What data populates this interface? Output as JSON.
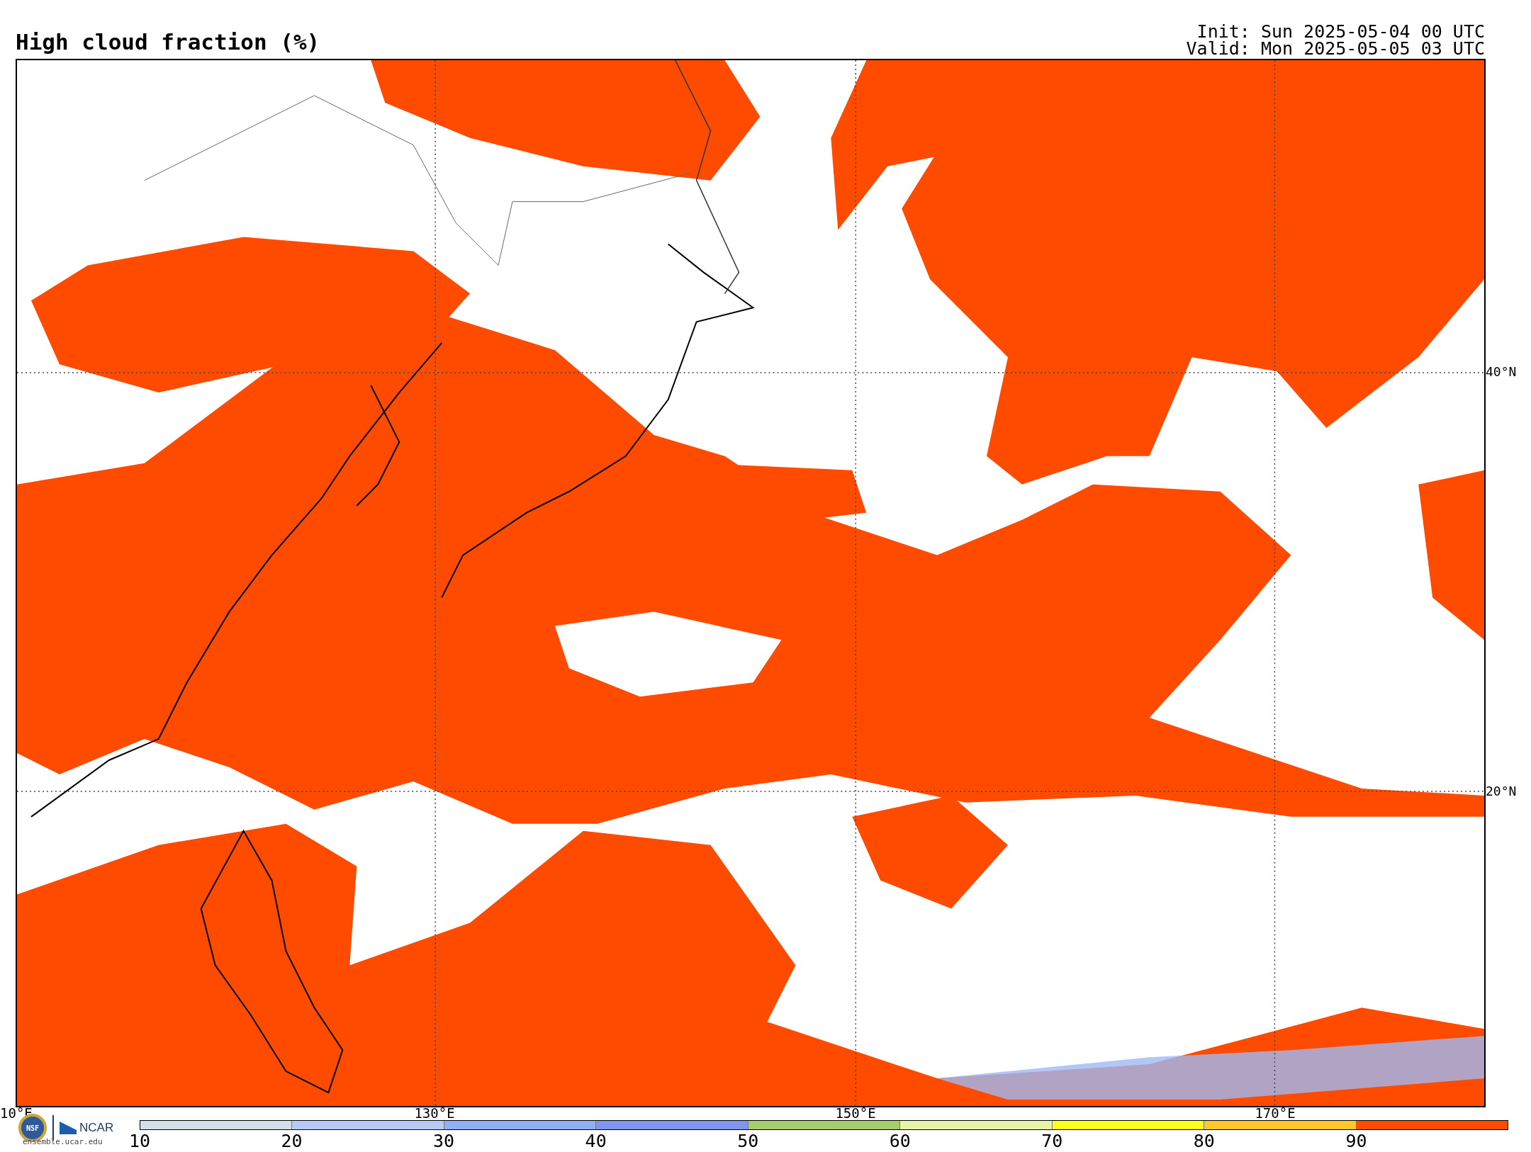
{
  "title": "High cloud fraction (%)",
  "init": "Init: Sun 2025-05-04 00 UTC",
  "valid": "Valid: Mon 2025-05-05 03 UTC",
  "map": {
    "lat_labels": [
      "40°N",
      "20°N"
    ],
    "lon_labels": [
      "10°E",
      "130°E",
      "150°E",
      "170°E"
    ]
  },
  "logo": {
    "nsf": "NSF",
    "ncar": "NCAR",
    "url": "ensemble.ucar.edu"
  },
  "colorbar": [
    {
      "label": "10",
      "color": "#d4e0e8"
    },
    {
      "label": "20",
      "color": "#b6cbf8"
    },
    {
      "label": "30",
      "color": "#8fb0f8"
    },
    {
      "label": "40",
      "color": "#7f95f4"
    },
    {
      "label": "50",
      "color": "#a6cc6b"
    },
    {
      "label": "60",
      "color": "#e8f5a6"
    },
    {
      "label": "70",
      "color": "#ffff19"
    },
    {
      "label": "80",
      "color": "#ffc72b"
    },
    {
      "label": "90",
      "color": "#ff4b00"
    }
  ]
}
